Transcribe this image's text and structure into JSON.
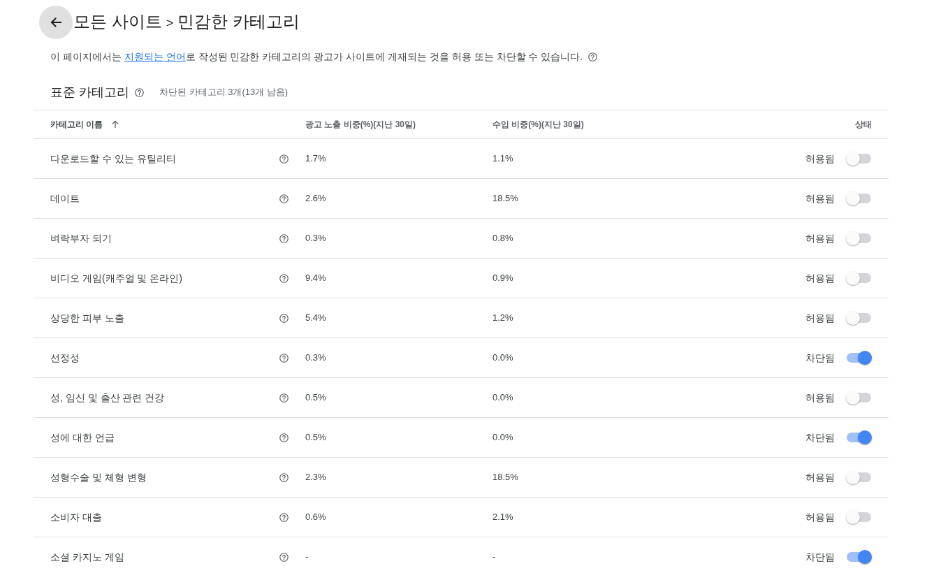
{
  "header": {
    "parent": "모든 사이트",
    "separator": ">",
    "current": "민감한 카테고리"
  },
  "description": {
    "before": "이 페이지에서는 ",
    "link": "지원되는 언어",
    "after": "로 작성된 민감한 카테고리의 광고가 사이트에 게재되는 것을 허용 또는 차단할 수 있습니다."
  },
  "section": {
    "title": "표준 카테고리",
    "summary": "차단된 카테고리 3개(13개 남음)"
  },
  "table": {
    "columns": [
      {
        "label": "카테고리 이름",
        "sorted": true
      },
      {
        "label": "광고 노출 비중(%)(지난 30일)",
        "sorted": false
      },
      {
        "label": "수입 비중(%)(지난 30일)",
        "sorted": false
      },
      {
        "label": "상태",
        "sorted": false
      }
    ],
    "rows": [
      {
        "name": "다운로드할 수 있는 유틸리티",
        "impressions": "1.7%",
        "revenue": "1.1%",
        "status": "허용됨",
        "blocked": false
      },
      {
        "name": "데이트",
        "impressions": "2.6%",
        "revenue": "18.5%",
        "status": "허용됨",
        "blocked": false
      },
      {
        "name": "벼락부자 되기",
        "impressions": "0.3%",
        "revenue": "0.8%",
        "status": "허용됨",
        "blocked": false
      },
      {
        "name": "비디오 게임(캐주얼 및 온라인)",
        "impressions": "9.4%",
        "revenue": "0.9%",
        "status": "허용됨",
        "blocked": false
      },
      {
        "name": "상당한 피부 노출",
        "impressions": "5.4%",
        "revenue": "1.2%",
        "status": "허용됨",
        "blocked": false
      },
      {
        "name": "선정성",
        "impressions": "0.3%",
        "revenue": "0.0%",
        "status": "차단됨",
        "blocked": true
      },
      {
        "name": "성, 임신 및 출산 관련 건강",
        "impressions": "0.5%",
        "revenue": "0.0%",
        "status": "허용됨",
        "blocked": false
      },
      {
        "name": "성에 대한 언급",
        "impressions": "0.5%",
        "revenue": "0.0%",
        "status": "차단됨",
        "blocked": true
      },
      {
        "name": "성형수술 및 체형 변형",
        "impressions": "2.3%",
        "revenue": "18.5%",
        "status": "허용됨",
        "blocked": false
      },
      {
        "name": "소비자 대출",
        "impressions": "0.6%",
        "revenue": "2.1%",
        "status": "허용됨",
        "blocked": false
      },
      {
        "name": "소셜 카지노 게임",
        "impressions": "-",
        "revenue": "-",
        "status": "차단됨",
        "blocked": true
      }
    ]
  }
}
